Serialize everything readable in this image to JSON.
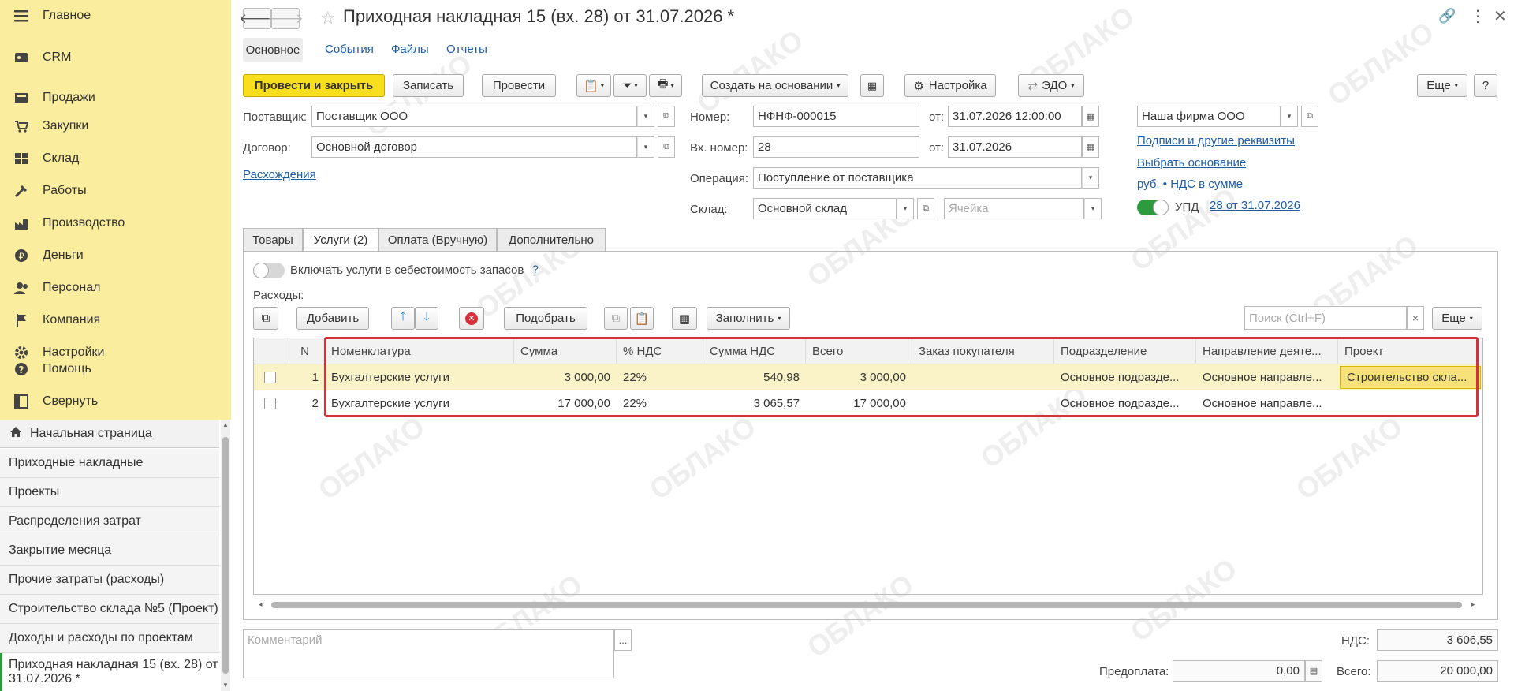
{
  "sidebar": {
    "sections": [
      {
        "label": "Главное",
        "icon": "menu-icon"
      },
      {
        "label": "CRM",
        "icon": "crm-icon"
      },
      {
        "label": "Продажи",
        "icon": "sales-icon"
      },
      {
        "label": "Закупки",
        "icon": "purchases-icon"
      },
      {
        "label": "Склад",
        "icon": "warehouse-icon"
      },
      {
        "label": "Работы",
        "icon": "works-icon"
      },
      {
        "label": "Производство",
        "icon": "production-icon"
      },
      {
        "label": "Деньги",
        "icon": "money-icon"
      },
      {
        "label": "Персонал",
        "icon": "personnel-icon"
      },
      {
        "label": "Компания",
        "icon": "company-icon"
      },
      {
        "label": "Настройки",
        "icon": "settings-icon"
      },
      {
        "label": "Помощь",
        "icon": "help-icon"
      },
      {
        "label": "Свернуть",
        "icon": "collapse-icon"
      }
    ],
    "home": "Начальная страница",
    "open_windows": [
      "Приходные накладные",
      "Проекты",
      "Распределения затрат",
      "Закрытие месяца",
      "Прочие затраты (расходы)",
      "Строительство склада №5 (Проект)",
      "Доходы и расходы по проектам",
      "Приходная накладная 15 (вх. 28) от 31.07.2026 *"
    ]
  },
  "header": {
    "title": "Приходная накладная 15 (вх. 28) от 31.07.2026 *",
    "subtabs": [
      "Основное",
      "События",
      "Файлы",
      "Отчеты"
    ]
  },
  "toolbar": {
    "post_close": "Провести и закрыть",
    "save": "Записать",
    "post": "Провести",
    "create_based": "Создать на основании",
    "settings": "Настройка",
    "edo": "ЭДО",
    "more": "Еще",
    "help": "?"
  },
  "form": {
    "supplier_label": "Поставщик:",
    "supplier_value": "Поставщик ООО",
    "contract_label": "Договор:",
    "contract_value": "Основной договор",
    "discrepancies": "Расхождения",
    "number_label": "Номер:",
    "number_value": "НФНФ-000015",
    "from_label": "от:",
    "date_value": "31.07.2026 12:00:00",
    "in_number_label": "Вх. номер:",
    "in_number_value": "28",
    "in_date_value": "31.07.2026",
    "operation_label": "Операция:",
    "operation_value": "Поступление от поставщика",
    "warehouse_label": "Склад:",
    "warehouse_value": "Основной склад",
    "cell_placeholder": "Ячейка",
    "company_value": "Наша фирма ООО",
    "signatures_link": "Подписи и другие реквизиты",
    "choose_basis_link": "Выбрать основание",
    "vat_link": "руб. • НДС в сумме",
    "upd_label": "УПД",
    "upd_link": "28 от 31.07.2026"
  },
  "tabs": [
    "Товары",
    "Услуги (2)",
    "Оплата (Вручную)",
    "Дополнительно"
  ],
  "services": {
    "include_toggle": "Включать услуги в себестоимость запасов",
    "help": "?",
    "expenses_label": "Расходы:",
    "add": "Добавить",
    "pick": "Подобрать",
    "fill": "Заполнить",
    "search_placeholder": "Поиск (Ctrl+F)",
    "search_clear": "×",
    "more": "Еще",
    "columns": [
      "N",
      "Номенклатура",
      "Сумма",
      "% НДС",
      "Сумма НДС",
      "Всего",
      "Заказ покупателя",
      "Подразделение",
      "Направление деяте...",
      "Проект"
    ],
    "rows": [
      {
        "n": "1",
        "item": "Бухгалтерские услуги",
        "sum": "3 000,00",
        "vat_rate": "22%",
        "vat_sum": "540,98",
        "total": "3 000,00",
        "order": "",
        "dept": "Основное подразде...",
        "direction": "Основное направле...",
        "project": "Строительство скла..."
      },
      {
        "n": "2",
        "item": "Бухгалтерские услуги",
        "sum": "17 000,00",
        "vat_rate": "22%",
        "vat_sum": "3 065,57",
        "total": "17 000,00",
        "order": "",
        "dept": "Основное подразде...",
        "direction": "Основное направле...",
        "project": ""
      }
    ]
  },
  "footer": {
    "comment_placeholder": "Комментарий",
    "comment_more": "...",
    "vat_label": "НДС:",
    "vat_value": "3 606,55",
    "prepay_label": "Предоплата:",
    "prepay_value": "0,00",
    "total_label": "Всего:",
    "total_value": "20 000,00"
  },
  "watermark": "ОБЛАКО",
  "colors": {
    "sidebar_bg": "#fbed9e",
    "primary_btn": "#f7df1e",
    "link": "#1d5da7",
    "highlight_frame": "#d6303b",
    "selected_row": "#fbf3c8",
    "toggle_on": "#2d9a3d"
  }
}
